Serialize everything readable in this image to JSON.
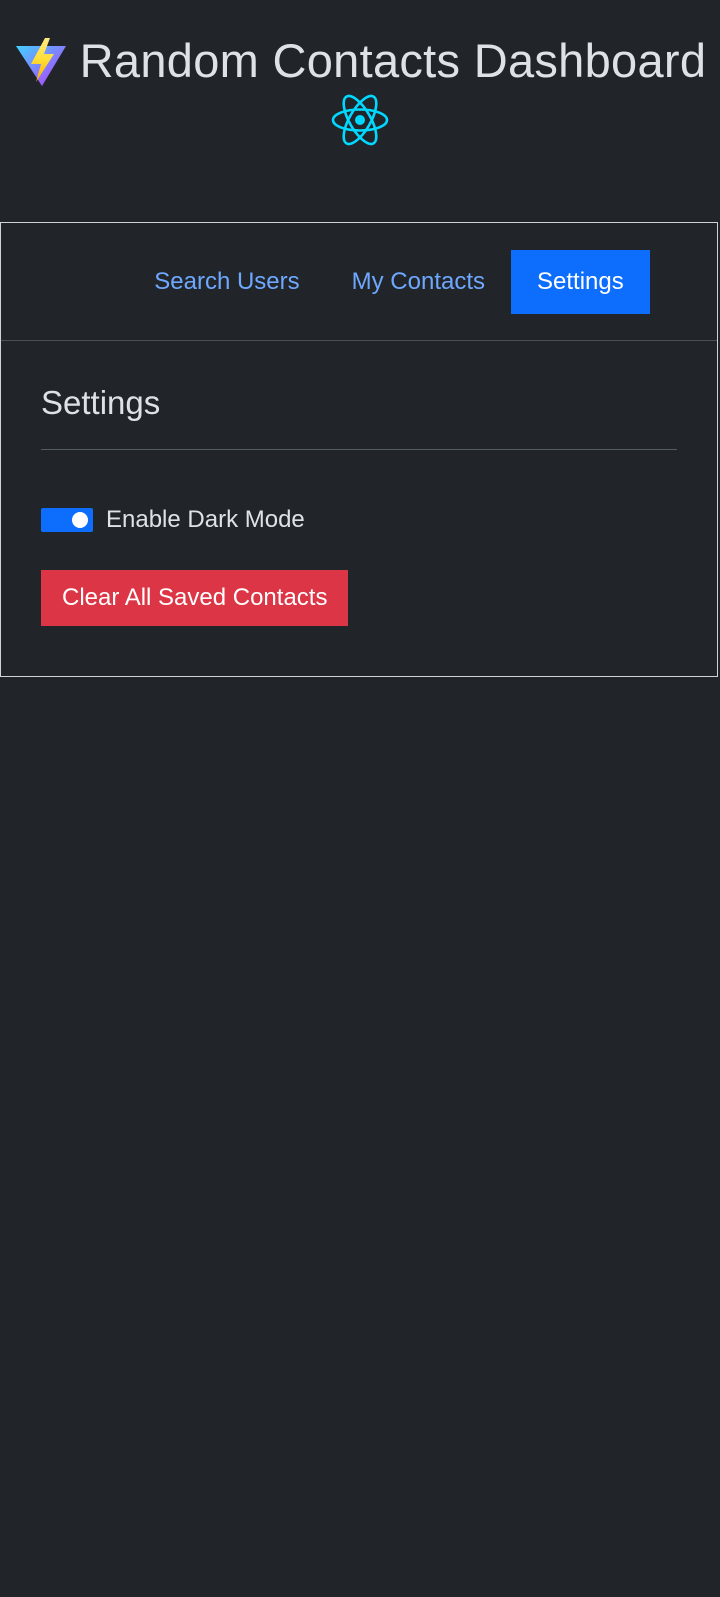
{
  "header": {
    "title": "Random Contacts Dashboard",
    "logos": [
      "vite-logo",
      "react-logo"
    ]
  },
  "nav": {
    "tabs": [
      {
        "label": "Search Users",
        "active": false
      },
      {
        "label": "My Contacts",
        "active": false
      },
      {
        "label": "Settings",
        "active": true
      }
    ]
  },
  "settings": {
    "title": "Settings",
    "dark_mode_label": "Enable Dark Mode",
    "dark_mode_enabled": true,
    "clear_button_label": "Clear All Saved Contacts"
  },
  "colors": {
    "background": "#212529",
    "primary": "#0d6efd",
    "link": "#6ea8fe",
    "danger": "#dc3545",
    "react": "#00d8ff"
  }
}
